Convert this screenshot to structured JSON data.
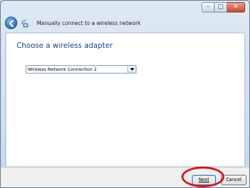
{
  "window": {
    "caption_buttons": {
      "minimize": "–",
      "maximize": "□",
      "close": "✕"
    }
  },
  "nav": {
    "title": "Manually connect to a wireless network"
  },
  "main": {
    "heading": "Choose a wireless adapter",
    "adapter_select": {
      "selected": "Wireless Network Connection 2"
    }
  },
  "footer": {
    "next_label": "Next",
    "cancel_label": "Cancel"
  },
  "colors": {
    "annotation": "#d8161b",
    "heading": "#1d3f8a"
  }
}
